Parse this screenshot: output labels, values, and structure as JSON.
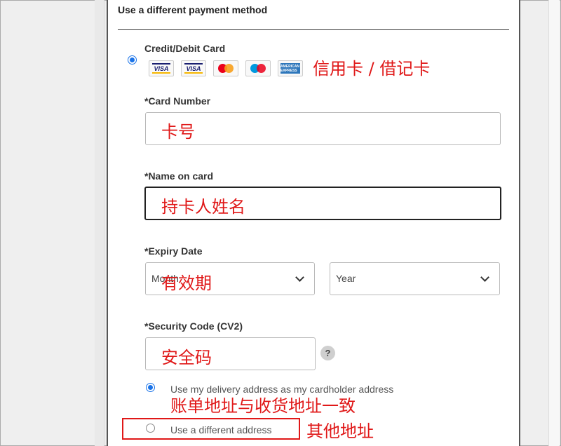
{
  "section_title": "Use a different payment method",
  "payment_method": {
    "label": "Credit/Debit Card",
    "selected": true,
    "cards": [
      {
        "icon": "visa-icon",
        "text": "VISA"
      },
      {
        "icon": "visa-electron-icon",
        "text": "VISA"
      },
      {
        "icon": "mastercard-icon",
        "text": ""
      },
      {
        "icon": "maestro-icon",
        "text": ""
      },
      {
        "icon": "amex-icon",
        "text": "AMERICAN EXPRESS"
      }
    ],
    "note": "信用卡 / 借记卡"
  },
  "card_number": {
    "label": "*Card Number",
    "value": "",
    "note": "卡号"
  },
  "name_on_card": {
    "label": "*Name on card",
    "value": "",
    "note": "持卡人姓名"
  },
  "expiry": {
    "label": "*Expiry Date",
    "month_value": "Month",
    "year_value": "Year",
    "note": "有效期"
  },
  "security_code": {
    "label": "*Security Code (CV2)",
    "value": "",
    "help": "?",
    "note": "安全码"
  },
  "billing": {
    "same_address_label": "Use my delivery address as my cardholder address",
    "same_address_selected": true,
    "same_note": "账单地址与收货地址一致",
    "different_address_label": "Use a different address",
    "different_address_selected": false,
    "different_note": "其他地址"
  },
  "colors": {
    "accent": "#1a73e8",
    "annotation": "#e01818"
  }
}
